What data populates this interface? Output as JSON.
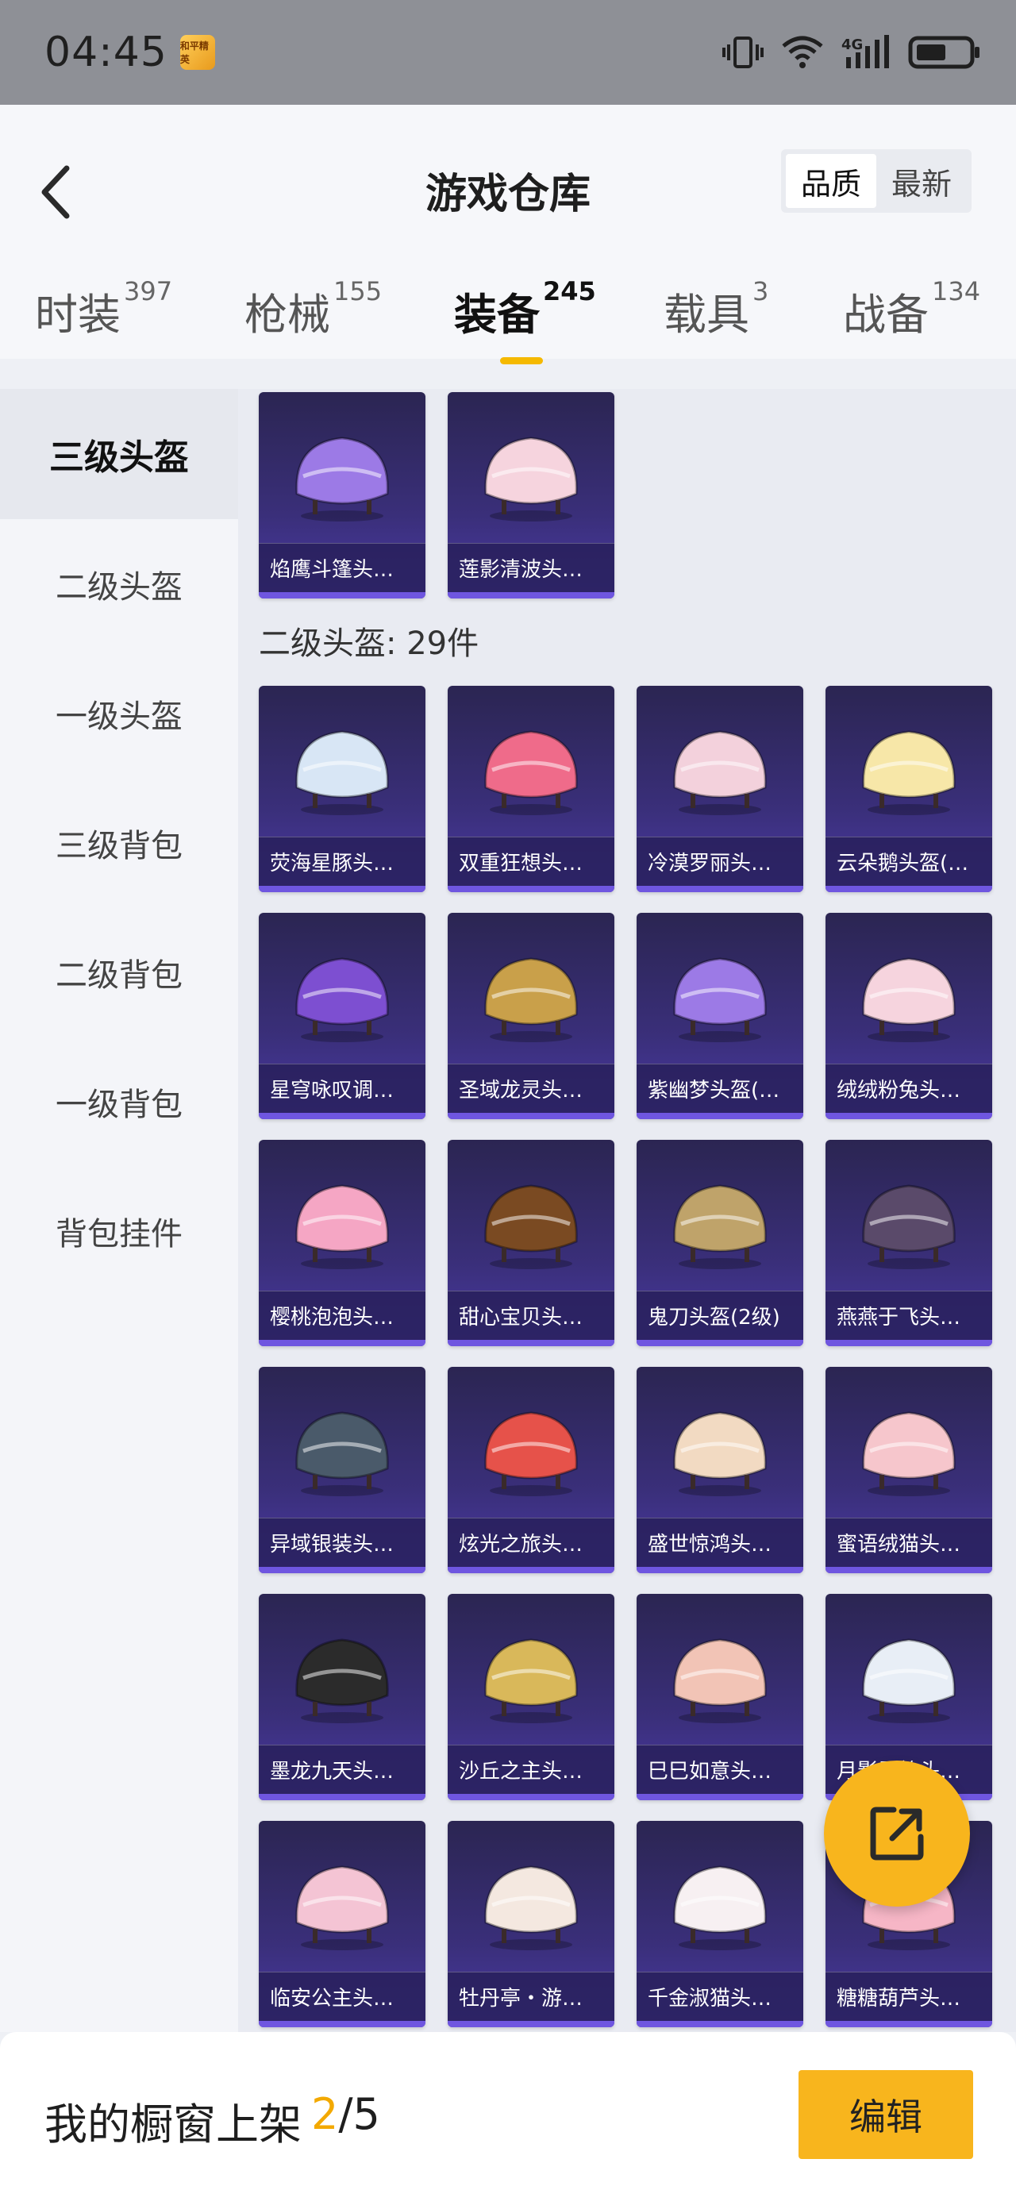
{
  "status_bar": {
    "time": "04:45",
    "app_badge": "和平精英",
    "network": "4G"
  },
  "header": {
    "title": "游戏仓库",
    "sort_options": [
      "品质",
      "最新"
    ],
    "active_sort": "品质"
  },
  "tabs": [
    {
      "label": "时装",
      "count": "397"
    },
    {
      "label": "枪械",
      "count": "155"
    },
    {
      "label": "装备",
      "count": "245"
    },
    {
      "label": "载具",
      "count": "3"
    },
    {
      "label": "战备",
      "count": "134"
    }
  ],
  "active_tab": "装备",
  "sidebar": {
    "items": [
      "三级头盔",
      "二级头盔",
      "一级头盔",
      "三级背包",
      "二级背包",
      "一级背包",
      "背包挂件"
    ],
    "active": "三级头盔"
  },
  "grid": {
    "top_items": [
      "焰鹰斗篷头…",
      "莲影清波头…"
    ],
    "section_title": "二级头盔: 29件",
    "items": [
      "荧海星豚头…",
      "双重狂想头…",
      "冷漠罗丽头…",
      "云朵鹅头盔(…",
      "星穹咏叹调…",
      "圣域龙灵头…",
      "紫幽梦头盔(…",
      "绒绒粉兔头…",
      "樱桃泡泡头…",
      "甜心宝贝头…",
      "鬼刀头盔(2级)",
      "燕燕于飞头…",
      "异域银装头…",
      "炫光之旅头…",
      "盛世惊鸿头…",
      "蜜语绒猫头…",
      "墨龙九天头…",
      "沙丘之主头…",
      "巳巳如意头…",
      "月影灵韵头…",
      "临安公主头…",
      "牡丹亭・游…",
      "千金淑猫头…",
      "糖糖葫芦头…"
    ]
  },
  "bottom_bar": {
    "label": "我的橱窗上架",
    "current": "2",
    "total": "/5",
    "edit_label": "编辑"
  },
  "colors": {
    "accent": "#f8b51d",
    "card_bg": "#3a2f7a",
    "card_border": "#6f56e0"
  },
  "icons": [
    "back-arrow-icon",
    "vibrate-icon",
    "wifi-icon",
    "signal-icon",
    "battery-icon",
    "share-out-icon"
  ]
}
